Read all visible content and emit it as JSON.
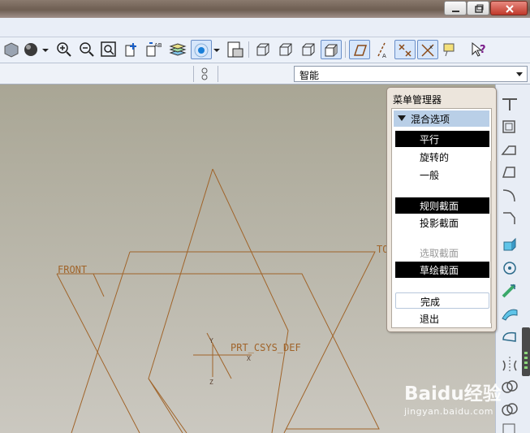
{
  "window": {
    "controls": {
      "minimize_icon": "minimize-icon",
      "maximize_icon": "restore-icon",
      "close_icon": "close-icon"
    }
  },
  "toolbar": {
    "icons": [
      "shaded-view-icon",
      "appearance-sphere-icon",
      "zoom-in-icon",
      "zoom-out-icon",
      "refit-icon",
      "reorient-icon",
      "saved-views-icon",
      "layers-icon",
      "spin-center-icon",
      "named-view-icon",
      "wireframe-icon",
      "hidden-line-icon",
      "no-hidden-icon",
      "shading-icon",
      "datum-planes-icon",
      "datum-axes-icon",
      "datum-points-icon",
      "csys-icon",
      "annotations-icon",
      "context-help-icon"
    ]
  },
  "filterbar": {
    "filter_value": "智能"
  },
  "viewport": {
    "datum_labels": {
      "front": "FRONT",
      "top": "TOP",
      "csys": "PRT_CSYS_DEF"
    },
    "axis_labels": {
      "x": "X",
      "y": "Y",
      "z": "Z"
    }
  },
  "menu_manager": {
    "title": "菜单管理器",
    "section": "混合选项",
    "items": [
      {
        "label": "平行",
        "state": "selected"
      },
      {
        "label": "旋转的",
        "state": "normal"
      },
      {
        "label": "一般",
        "state": "normal"
      },
      {
        "label": "规则截面",
        "state": "selected"
      },
      {
        "label": "投影截面",
        "state": "normal"
      },
      {
        "label": "选取截面",
        "state": "disabled"
      },
      {
        "label": "草绘截面",
        "state": "selected"
      },
      {
        "label": "完成",
        "state": "focused"
      },
      {
        "label": "退出",
        "state": "normal"
      }
    ]
  },
  "watermark": {
    "logo": "Baidu经验",
    "url": "jingyan.baidu.com"
  },
  "colors": {
    "datum": "#a0642a",
    "menu_header": "#b9cfe7",
    "selected_bg": "#000000"
  }
}
